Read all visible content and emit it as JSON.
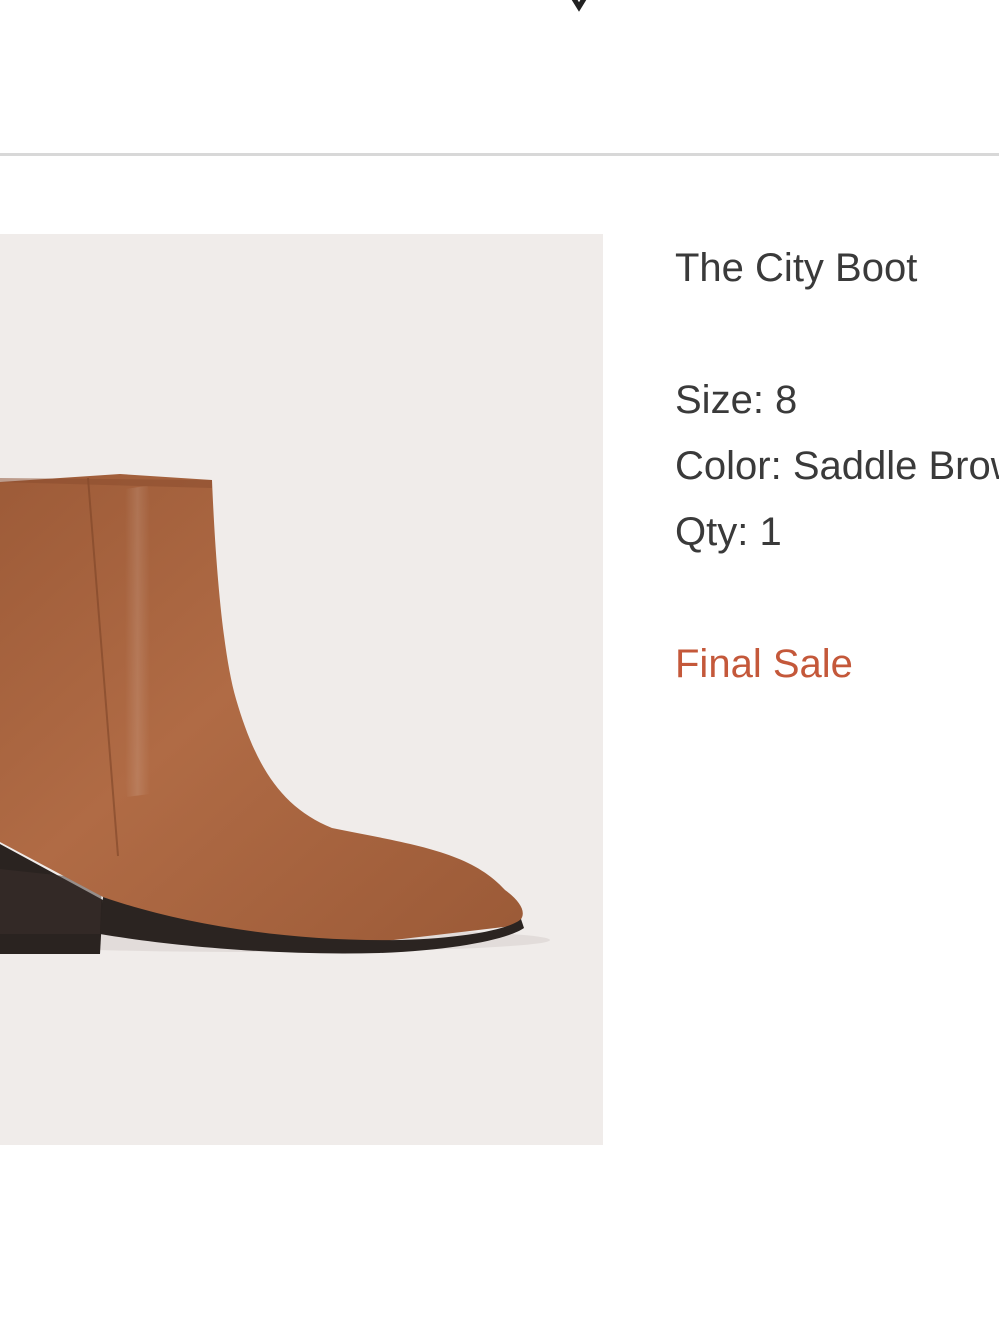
{
  "order_item": {
    "product_name": "The City Boot",
    "size_text": "Size: 8",
    "color_text": "Color: Saddle Brown",
    "qty_text": "Qty: 1",
    "sale_label": "Final Sale"
  },
  "colors": {
    "text": "#3a3a3a",
    "sale_accent": "#c4583a",
    "image_background": "#f0ecea",
    "boot_leather": "#a8653f",
    "boot_sole": "#2b2421"
  }
}
